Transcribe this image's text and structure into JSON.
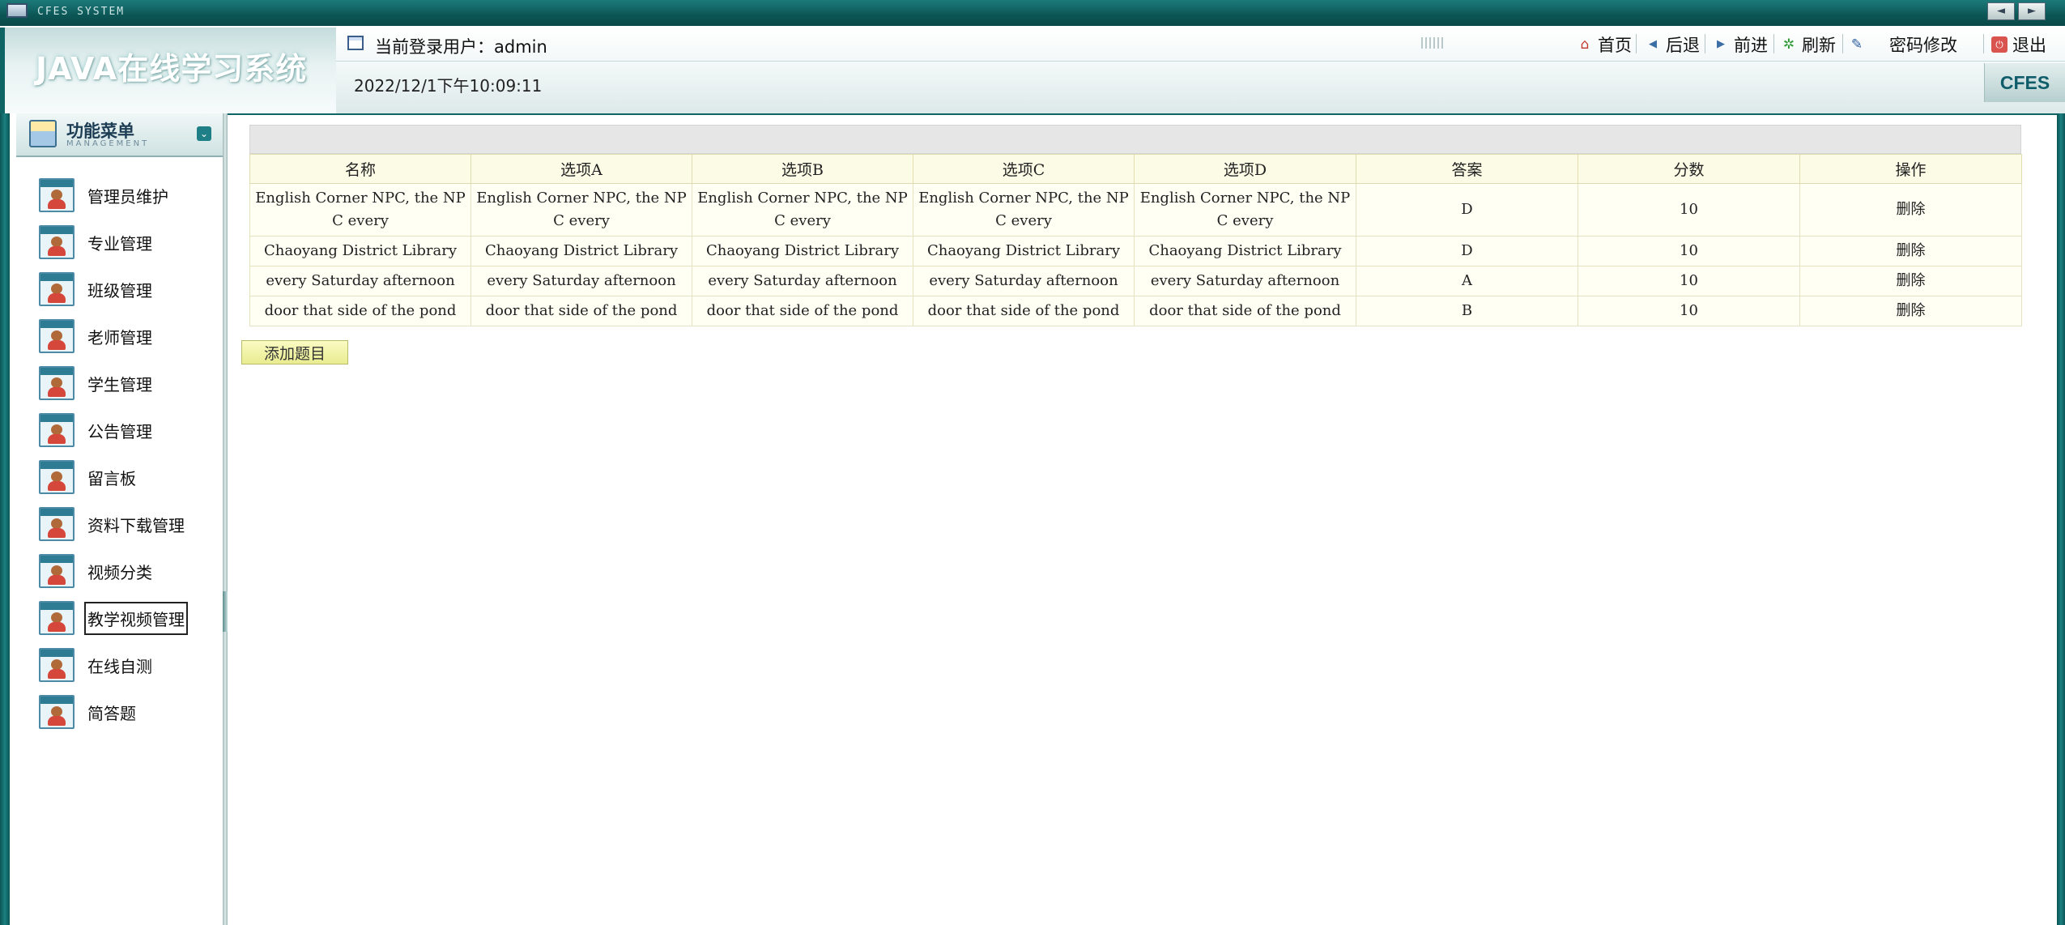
{
  "window": {
    "title": "CFES SYSTEM"
  },
  "header": {
    "app_title": "JAVA在线学习系统",
    "current_user_label": "当前登录用户：admin",
    "datetime": "2022/12/1下午10:09:11",
    "badge": "CFES",
    "nav": [
      {
        "label": "首页",
        "icon": "home-icon"
      },
      {
        "label": "后退",
        "icon": "back-icon"
      },
      {
        "label": "前进",
        "icon": "forward-icon"
      },
      {
        "label": "刷新",
        "icon": "refresh-icon"
      },
      {
        "label": "密码修改",
        "icon": "edit-password-icon"
      },
      {
        "label": "退出",
        "icon": "exit-icon"
      }
    ]
  },
  "sidebar": {
    "heading": "功能菜单",
    "heading_sub": "MANAGEMENT",
    "items": [
      {
        "label": "管理员维护"
      },
      {
        "label": "专业管理"
      },
      {
        "label": "班级管理"
      },
      {
        "label": "老师管理"
      },
      {
        "label": "学生管理"
      },
      {
        "label": "公告管理"
      },
      {
        "label": "留言板"
      },
      {
        "label": "资料下载管理"
      },
      {
        "label": "视频分类"
      },
      {
        "label": "教学视频管理"
      },
      {
        "label": "在线自测"
      },
      {
        "label": "简答题"
      }
    ],
    "active_index": 9
  },
  "table": {
    "columns": [
      "名称",
      "选项A",
      "选项B",
      "选项C",
      "选项D",
      "答案",
      "分数",
      "操作"
    ],
    "rows": [
      {
        "name": "English Corner NPC, the NPC every",
        "a": "English Corner NPC, the NPC every",
        "b": "English Corner NPC, the NPC every",
        "c": "English Corner NPC, the NPC every",
        "d": "English Corner NPC, the NPC every",
        "answer": "D",
        "score": "10",
        "action": "删除"
      },
      {
        "name": "Chaoyang District Library",
        "a": "Chaoyang District Library",
        "b": "Chaoyang District Library",
        "c": "Chaoyang District Library",
        "d": "Chaoyang District Library",
        "answer": "D",
        "score": "10",
        "action": "删除"
      },
      {
        "name": "every Saturday afternoon",
        "a": "every Saturday afternoon",
        "b": "every Saturday afternoon",
        "c": "every Saturday afternoon",
        "d": "every Saturday afternoon",
        "answer": "A",
        "score": "10",
        "action": "删除"
      },
      {
        "name": "door that side of the pond",
        "a": "door that side of the pond",
        "b": "door that side of the pond",
        "c": "door that side of the pond",
        "d": "door that side of the pond",
        "answer": "B",
        "score": "10",
        "action": "删除"
      }
    ],
    "add_button": "添加题目"
  },
  "colors": {
    "frame": "#0f6464",
    "header_accent": "#1c8080",
    "table_header_bg": "#fbfbe6",
    "add_button": "#e9ec90"
  }
}
